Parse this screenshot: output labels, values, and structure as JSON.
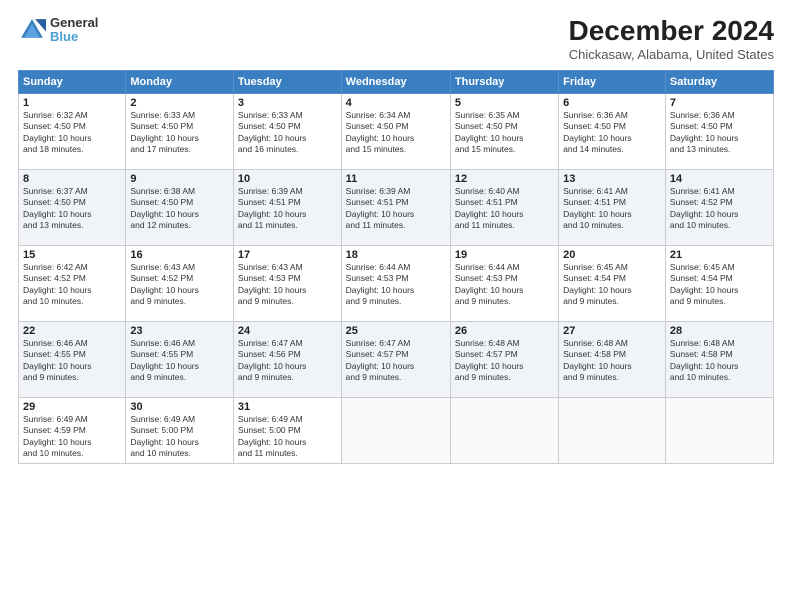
{
  "logo": {
    "line1": "General",
    "line2": "Blue"
  },
  "title": "December 2024",
  "subtitle": "Chickasaw, Alabama, United States",
  "days_of_week": [
    "Sunday",
    "Monday",
    "Tuesday",
    "Wednesday",
    "Thursday",
    "Friday",
    "Saturday"
  ],
  "weeks": [
    [
      {
        "day": "1",
        "info": "Sunrise: 6:32 AM\nSunset: 4:50 PM\nDaylight: 10 hours\nand 18 minutes."
      },
      {
        "day": "2",
        "info": "Sunrise: 6:33 AM\nSunset: 4:50 PM\nDaylight: 10 hours\nand 17 minutes."
      },
      {
        "day": "3",
        "info": "Sunrise: 6:33 AM\nSunset: 4:50 PM\nDaylight: 10 hours\nand 16 minutes."
      },
      {
        "day": "4",
        "info": "Sunrise: 6:34 AM\nSunset: 4:50 PM\nDaylight: 10 hours\nand 15 minutes."
      },
      {
        "day": "5",
        "info": "Sunrise: 6:35 AM\nSunset: 4:50 PM\nDaylight: 10 hours\nand 15 minutes."
      },
      {
        "day": "6",
        "info": "Sunrise: 6:36 AM\nSunset: 4:50 PM\nDaylight: 10 hours\nand 14 minutes."
      },
      {
        "day": "7",
        "info": "Sunrise: 6:36 AM\nSunset: 4:50 PM\nDaylight: 10 hours\nand 13 minutes."
      }
    ],
    [
      {
        "day": "8",
        "info": "Sunrise: 6:37 AM\nSunset: 4:50 PM\nDaylight: 10 hours\nand 13 minutes."
      },
      {
        "day": "9",
        "info": "Sunrise: 6:38 AM\nSunset: 4:50 PM\nDaylight: 10 hours\nand 12 minutes."
      },
      {
        "day": "10",
        "info": "Sunrise: 6:39 AM\nSunset: 4:51 PM\nDaylight: 10 hours\nand 11 minutes."
      },
      {
        "day": "11",
        "info": "Sunrise: 6:39 AM\nSunset: 4:51 PM\nDaylight: 10 hours\nand 11 minutes."
      },
      {
        "day": "12",
        "info": "Sunrise: 6:40 AM\nSunset: 4:51 PM\nDaylight: 10 hours\nand 11 minutes."
      },
      {
        "day": "13",
        "info": "Sunrise: 6:41 AM\nSunset: 4:51 PM\nDaylight: 10 hours\nand 10 minutes."
      },
      {
        "day": "14",
        "info": "Sunrise: 6:41 AM\nSunset: 4:52 PM\nDaylight: 10 hours\nand 10 minutes."
      }
    ],
    [
      {
        "day": "15",
        "info": "Sunrise: 6:42 AM\nSunset: 4:52 PM\nDaylight: 10 hours\nand 10 minutes."
      },
      {
        "day": "16",
        "info": "Sunrise: 6:43 AM\nSunset: 4:52 PM\nDaylight: 10 hours\nand 9 minutes."
      },
      {
        "day": "17",
        "info": "Sunrise: 6:43 AM\nSunset: 4:53 PM\nDaylight: 10 hours\nand 9 minutes."
      },
      {
        "day": "18",
        "info": "Sunrise: 6:44 AM\nSunset: 4:53 PM\nDaylight: 10 hours\nand 9 minutes."
      },
      {
        "day": "19",
        "info": "Sunrise: 6:44 AM\nSunset: 4:53 PM\nDaylight: 10 hours\nand 9 minutes."
      },
      {
        "day": "20",
        "info": "Sunrise: 6:45 AM\nSunset: 4:54 PM\nDaylight: 10 hours\nand 9 minutes."
      },
      {
        "day": "21",
        "info": "Sunrise: 6:45 AM\nSunset: 4:54 PM\nDaylight: 10 hours\nand 9 minutes."
      }
    ],
    [
      {
        "day": "22",
        "info": "Sunrise: 6:46 AM\nSunset: 4:55 PM\nDaylight: 10 hours\nand 9 minutes."
      },
      {
        "day": "23",
        "info": "Sunrise: 6:46 AM\nSunset: 4:55 PM\nDaylight: 10 hours\nand 9 minutes."
      },
      {
        "day": "24",
        "info": "Sunrise: 6:47 AM\nSunset: 4:56 PM\nDaylight: 10 hours\nand 9 minutes."
      },
      {
        "day": "25",
        "info": "Sunrise: 6:47 AM\nSunset: 4:57 PM\nDaylight: 10 hours\nand 9 minutes."
      },
      {
        "day": "26",
        "info": "Sunrise: 6:48 AM\nSunset: 4:57 PM\nDaylight: 10 hours\nand 9 minutes."
      },
      {
        "day": "27",
        "info": "Sunrise: 6:48 AM\nSunset: 4:58 PM\nDaylight: 10 hours\nand 9 minutes."
      },
      {
        "day": "28",
        "info": "Sunrise: 6:48 AM\nSunset: 4:58 PM\nDaylight: 10 hours\nand 10 minutes."
      }
    ],
    [
      {
        "day": "29",
        "info": "Sunrise: 6:49 AM\nSunset: 4:59 PM\nDaylight: 10 hours\nand 10 minutes."
      },
      {
        "day": "30",
        "info": "Sunrise: 6:49 AM\nSunset: 5:00 PM\nDaylight: 10 hours\nand 10 minutes."
      },
      {
        "day": "31",
        "info": "Sunrise: 6:49 AM\nSunset: 5:00 PM\nDaylight: 10 hours\nand 11 minutes."
      },
      null,
      null,
      null,
      null
    ]
  ]
}
